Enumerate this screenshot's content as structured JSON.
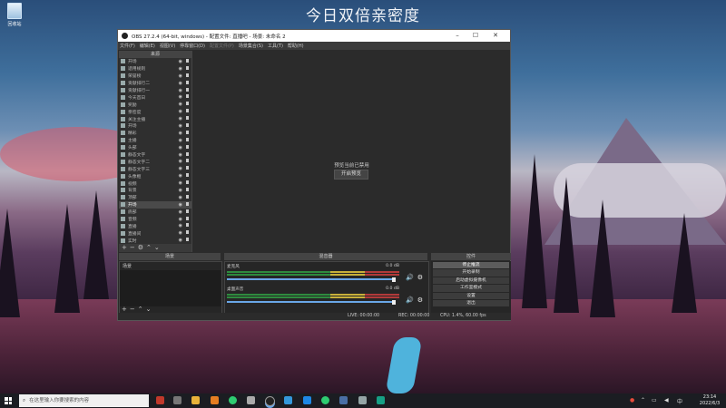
{
  "banner": "今日双倍亲密度",
  "desktop": {
    "recycle_label": "回收站"
  },
  "obs": {
    "title": "OBS 27.2.4 (64-bit, windows) - 配置文件: 直播吧 - 场景: 未命名 2",
    "menu": [
      {
        "label": "文件(F)",
        "enabled": true
      },
      {
        "label": "编辑(E)",
        "enabled": true
      },
      {
        "label": "视图(V)",
        "enabled": true
      },
      {
        "label": "停靠窗口(D)",
        "enabled": true
      },
      {
        "label": "配置文件(P)",
        "enabled": false
      },
      {
        "label": "场景集合(S)",
        "enabled": true
      },
      {
        "label": "工具(T)",
        "enabled": true
      },
      {
        "label": "帮助(H)",
        "enabled": true
      }
    ],
    "sources_title": "来源",
    "sources": [
      "开场",
      "适用规则",
      "荣誉榜",
      "贡献排行二",
      "贡献排行一",
      "今天首日",
      "奖励",
      "亲密度",
      "关注主播",
      "开场",
      "精彩",
      "主播",
      "头部",
      "静态文字",
      "静态文字二",
      "静态文字三",
      "头像框",
      "视频",
      "背景",
      "顶部",
      "开场",
      "底部",
      "音频",
      "直播",
      "直播间",
      "实时",
      "开场",
      "直播",
      "音乐",
      "直播信息",
      "背景",
      "直播",
      "开场",
      "监控组"
    ],
    "preview_text": "预览当前已禁用",
    "preview_button": "开启预览",
    "scenes_title": "场景",
    "scene_item": "场景",
    "mixer_title": "混音器",
    "channels": [
      {
        "name": "麦克风",
        "db": "0.0 dB"
      },
      {
        "name": "桌面声音",
        "db": "0.0 dB"
      }
    ],
    "controls_title": "控件",
    "controls": [
      "停止推流",
      "开始录制",
      "启动虚拟摄像机",
      "工作室模式",
      "设置",
      "退出"
    ],
    "status": {
      "live": "LIVE: 00:00:00",
      "rec": "REC: 00:00:00",
      "cpu": "CPU: 1.4%, 60.00 fps"
    }
  },
  "taskbar": {
    "search_placeholder": "在这里输入你要搜索的内容",
    "time": "23:14",
    "date": "2022/6/3"
  }
}
